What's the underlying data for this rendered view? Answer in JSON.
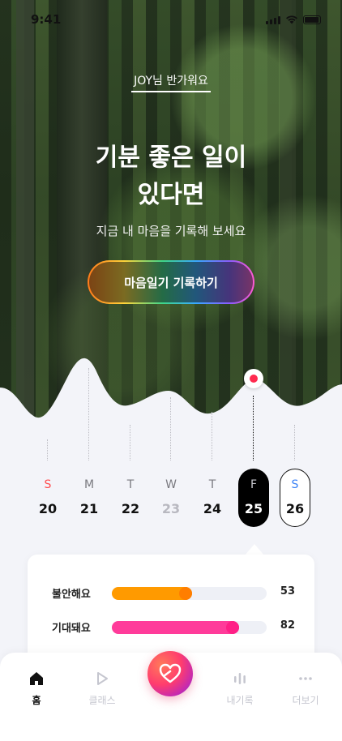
{
  "status": {
    "time": "9:41"
  },
  "hero": {
    "greeting": "JOY님 반가워요",
    "headline_line1": "기분 좋은 일이",
    "headline_line2": "있다면",
    "subtitle": "지금 내 마음을 기록해 보세요",
    "cta_label": "마음일기 기록하기"
  },
  "calendar": {
    "days": [
      {
        "letter": "S",
        "number": "20",
        "letter_color": "#ff4d4f"
      },
      {
        "letter": "M",
        "number": "21"
      },
      {
        "letter": "T",
        "number": "22"
      },
      {
        "letter": "W",
        "number": "23",
        "muted": true
      },
      {
        "letter": "T",
        "number": "24"
      },
      {
        "letter": "F",
        "number": "25",
        "selected": true
      },
      {
        "letter": "S",
        "number": "26",
        "letter_color": "#3b82f6",
        "today": true
      }
    ]
  },
  "moods": [
    {
      "label": "불안해요",
      "value": "53",
      "fraction": 0.52,
      "color": "#ff9a00",
      "knob_color": "#ff7e00"
    },
    {
      "label": "기대돼요",
      "value": "82",
      "fraction": 0.82,
      "color": "#ff3b9a",
      "knob_color": "#ff1f86"
    }
  ],
  "nav": {
    "home": "홈",
    "class": "클래스",
    "record": "내기록",
    "more": "더보기"
  }
}
